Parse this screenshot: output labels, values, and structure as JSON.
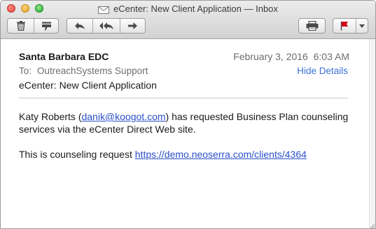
{
  "window": {
    "title": "eCenter: New Client Application — Inbox"
  },
  "toolbar": {
    "icons": [
      "trash-icon",
      "junk-icon",
      "reply-icon",
      "reply-all-icon",
      "forward-icon",
      "printer-icon",
      "flag-icon",
      "chevron-down-icon"
    ],
    "flag_color": "#d0021b"
  },
  "message": {
    "from": "Santa Barbara EDC",
    "date": "February 3, 2016",
    "time": "6:03 AM",
    "to_label": "To:",
    "to": "OutreachSystems Support",
    "hide_details": "Hide Details",
    "subject": "eCenter: New Client Application",
    "body": {
      "sender_name": "Katy Roberts (",
      "sender_email": "danik@koogot.com",
      "request_text_1": ") has requested Business Plan counseling",
      "request_text_2": "services via the eCenter Direct Web site.",
      "request_label": "This is counseling request ",
      "request_link": "https://demo.neoserra.com/clients/4364"
    }
  },
  "colors": {
    "link": "#2a4fc9",
    "hide_details": "#3b73d6",
    "muted_text": "#6e6e6e"
  }
}
